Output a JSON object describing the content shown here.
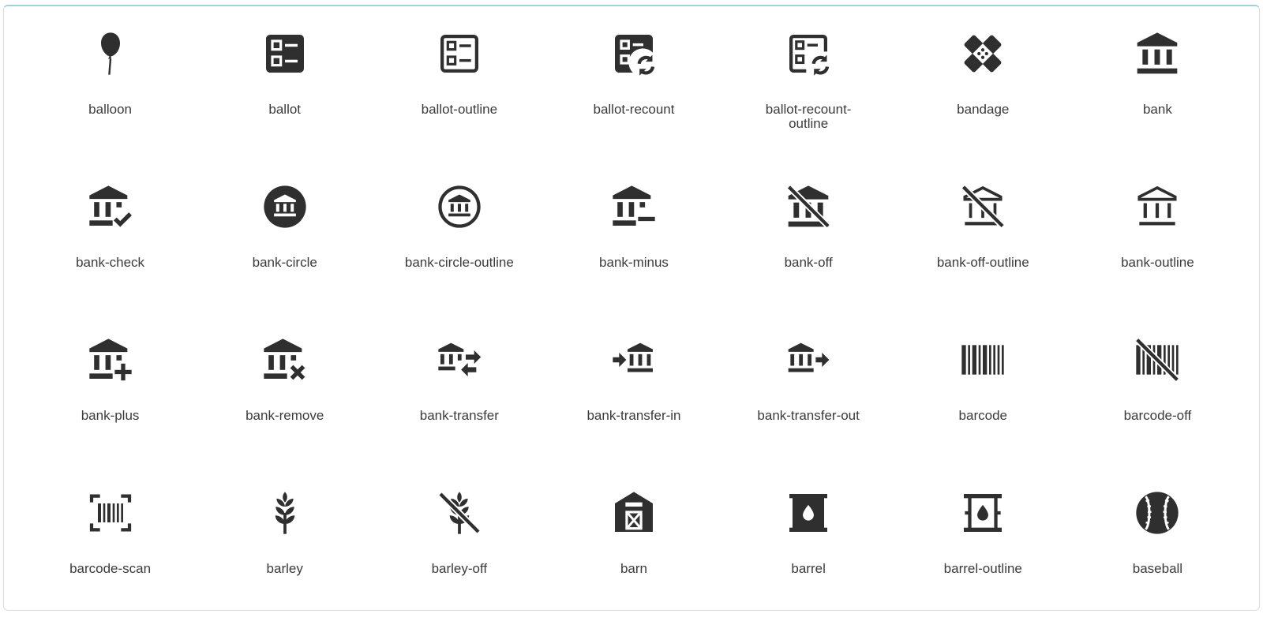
{
  "icons": [
    {
      "label": "balloon",
      "icon": "balloon-icon"
    },
    {
      "label": "ballot",
      "icon": "ballot-icon"
    },
    {
      "label": "ballot-outline",
      "icon": "ballot-outline-icon"
    },
    {
      "label": "ballot-recount",
      "icon": "ballot-recount-icon"
    },
    {
      "label": "ballot-recount-outline",
      "icon": "ballot-recount-outline-icon"
    },
    {
      "label": "bandage",
      "icon": "bandage-icon"
    },
    {
      "label": "bank",
      "icon": "bank-icon"
    },
    {
      "label": "bank-check",
      "icon": "bank-check-icon"
    },
    {
      "label": "bank-circle",
      "icon": "bank-circle-icon"
    },
    {
      "label": "bank-circle-outline",
      "icon": "bank-circle-outline-icon"
    },
    {
      "label": "bank-minus",
      "icon": "bank-minus-icon"
    },
    {
      "label": "bank-off",
      "icon": "bank-off-icon"
    },
    {
      "label": "bank-off-outline",
      "icon": "bank-off-outline-icon"
    },
    {
      "label": "bank-outline",
      "icon": "bank-outline-icon"
    },
    {
      "label": "bank-plus",
      "icon": "bank-plus-icon"
    },
    {
      "label": "bank-remove",
      "icon": "bank-remove-icon"
    },
    {
      "label": "bank-transfer",
      "icon": "bank-transfer-icon"
    },
    {
      "label": "bank-transfer-in",
      "icon": "bank-transfer-in-icon"
    },
    {
      "label": "bank-transfer-out",
      "icon": "bank-transfer-out-icon"
    },
    {
      "label": "barcode",
      "icon": "barcode-icon"
    },
    {
      "label": "barcode-off",
      "icon": "barcode-off-icon"
    },
    {
      "label": "barcode-scan",
      "icon": "barcode-scan-icon"
    },
    {
      "label": "barley",
      "icon": "barley-icon"
    },
    {
      "label": "barley-off",
      "icon": "barley-off-icon"
    },
    {
      "label": "barn",
      "icon": "barn-icon"
    },
    {
      "label": "barrel",
      "icon": "barrel-icon"
    },
    {
      "label": "barrel-outline",
      "icon": "barrel-outline-icon"
    },
    {
      "label": "baseball",
      "icon": "baseball-icon"
    }
  ],
  "colors": {
    "icon": "#2f2f2f",
    "label": "#3b3b3b",
    "panel_border": "#dcdcdc",
    "accent_top": "#9fd3e3"
  }
}
